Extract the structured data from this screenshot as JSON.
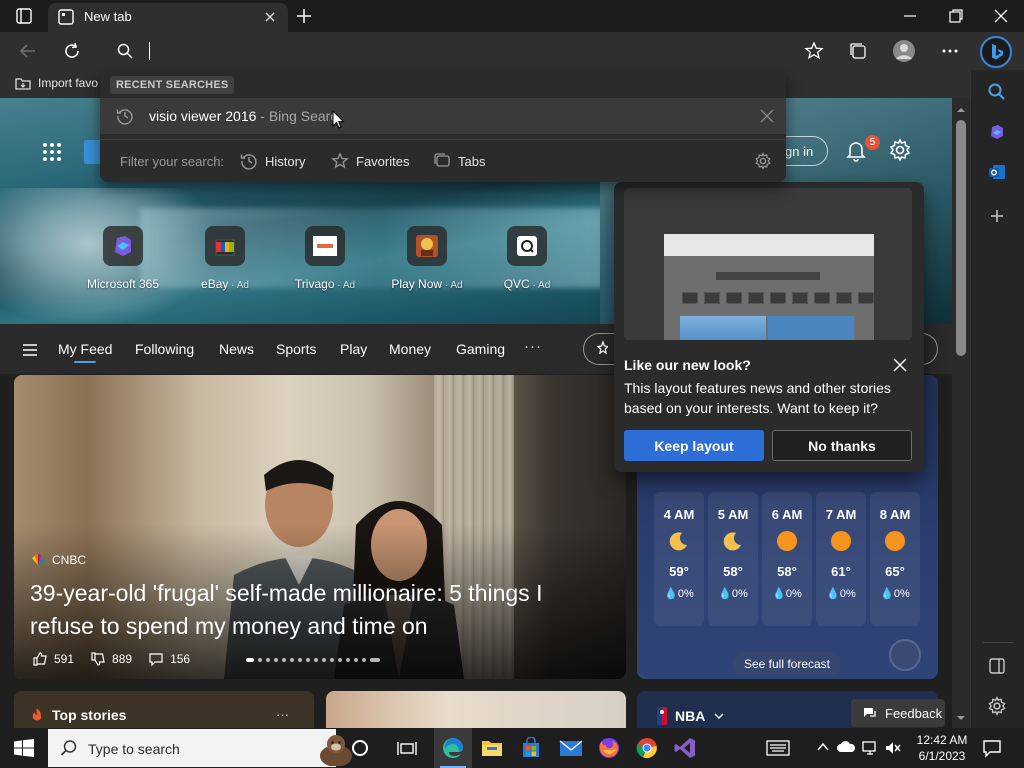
{
  "browser": {
    "tab_title": "New tab",
    "favorites_bar_item": "Import favo"
  },
  "dropdown": {
    "recent_label": "RECENT SEARCHES",
    "suggestion_query": "visio viewer 2016",
    "suggestion_source": " - Bing Searc",
    "filter_label": "Filter your search:",
    "filters": [
      "History",
      "Favorites",
      "Tabs"
    ]
  },
  "header": {
    "signin_label": "gn in",
    "notification_count": "5"
  },
  "quick_links": [
    {
      "label": "Microsoft 365",
      "ad": ""
    },
    {
      "label": "eBay",
      "ad": " · Ad"
    },
    {
      "label": "Trivago",
      "ad": " · Ad"
    },
    {
      "label": "Play Now",
      "ad": " · Ad"
    },
    {
      "label": "QVC",
      "ad": " · Ad"
    }
  ],
  "feed_nav": {
    "items": [
      "My Feed",
      "Following",
      "News",
      "Sports",
      "Play",
      "Money",
      "Gaming"
    ],
    "more": "···"
  },
  "hero_article": {
    "source": "CNBC",
    "headline": "39-year-old 'frugal' self-made millionaire: 5 things I refuse to spend my money and time on",
    "likes": "591",
    "dislikes": "889",
    "comments": "156"
  },
  "weather": {
    "hours": [
      {
        "time": "4 AM",
        "icon": "moon-icon",
        "temp": "59°",
        "precip": "0%"
      },
      {
        "time": "5 AM",
        "icon": "moon-icon",
        "temp": "58°",
        "precip": "0%"
      },
      {
        "time": "6 AM",
        "icon": "sun-icon",
        "temp": "58°",
        "precip": "0%"
      },
      {
        "time": "7 AM",
        "icon": "sun-icon",
        "temp": "61°",
        "precip": "0%"
      },
      {
        "time": "8 AM",
        "icon": "sun-icon",
        "temp": "65°",
        "precip": "0%"
      }
    ],
    "forecast_label": "See full forecast"
  },
  "bottom_cards": {
    "top_stories": "Top stories",
    "more": "···",
    "nba": "NBA"
  },
  "feedback_label": "Feedback",
  "popup": {
    "title": "Like our new look?",
    "body": "This layout features news and other stories based on your interests. Want to keep it?",
    "keep_label": "Keep layout",
    "no_label": "No thanks"
  },
  "taskbar": {
    "search_placeholder": "Type to search",
    "time": "12:42 AM",
    "date": "6/1/2023"
  },
  "colors": {
    "accent": "#2d6fd6",
    "nav_underline": "#4ba0e8",
    "badge": "#e5533d"
  }
}
